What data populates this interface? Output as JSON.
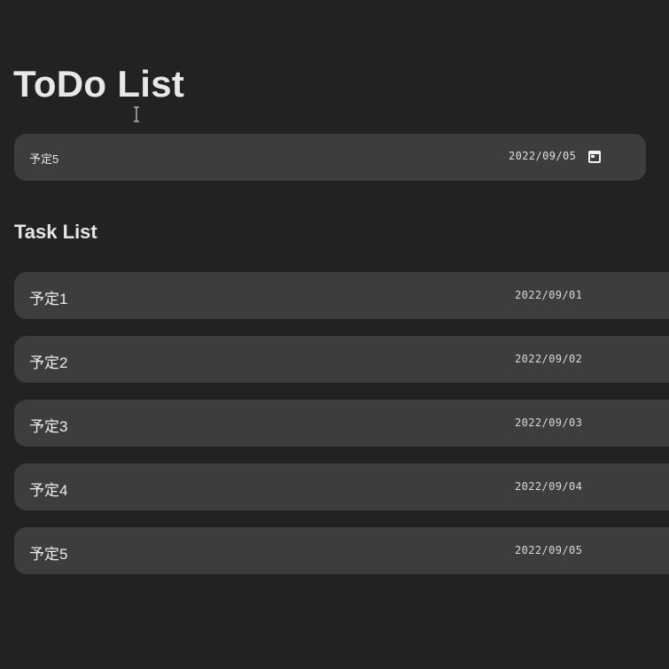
{
  "app": {
    "title": "ToDo List"
  },
  "new_task": {
    "name_value": "予定5",
    "date_value": "2022/09/05",
    "calendar_icon": "calendar-icon"
  },
  "task_section": {
    "title": "Task List",
    "tasks": [
      {
        "name": "予定1",
        "date": "2022/09/01"
      },
      {
        "name": "予定2",
        "date": "2022/09/02"
      },
      {
        "name": "予定3",
        "date": "2022/09/03"
      },
      {
        "name": "予定4",
        "date": "2022/09/04"
      },
      {
        "name": "予定5",
        "date": "2022/09/05"
      }
    ]
  },
  "colors": {
    "background": "#222222",
    "card": "#3d3d3d",
    "text": "#e6e6e6"
  }
}
